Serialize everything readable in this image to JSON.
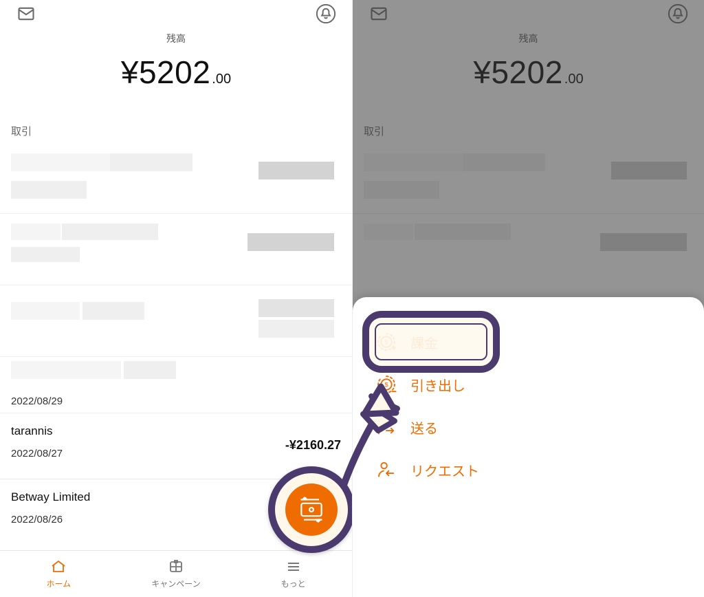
{
  "left": {
    "balance_label": "残高",
    "balance_main": "¥5202",
    "balance_cents": ".00",
    "tx_header": "取引",
    "transactions": [
      {
        "name": "tarannis",
        "date": "2022/08/27",
        "amount": "-¥2160.27"
      },
      {
        "name": "Betway Limited",
        "date": "2022/08/26",
        "amount": ""
      }
    ],
    "nav": {
      "home": "ホーム",
      "campaign": "キャンペーン",
      "more": "もっと"
    },
    "hidden_date": "2022/08/29"
  },
  "right": {
    "balance_label": "残高",
    "balance_main": "¥5202",
    "balance_cents": ".00",
    "tx_header": "取引",
    "sheet": {
      "deposit": "課金",
      "withdraw": "引き出し",
      "send": "送る",
      "request": "リクエスト"
    }
  },
  "colors": {
    "accent": "#ef6c00",
    "annotation": "#4b3a6e"
  }
}
